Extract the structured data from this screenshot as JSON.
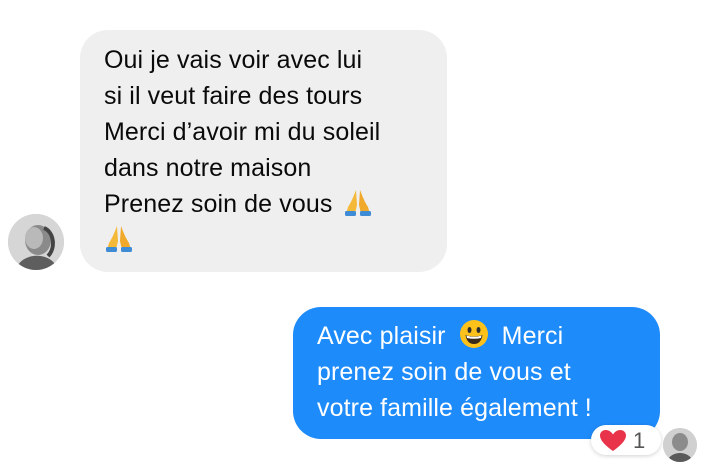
{
  "conversation": {
    "incoming_message": {
      "lines": [
        "Oui je vais voir avec lui",
        "si il veut faire des tours",
        "Merci d’avoir mi du soleil",
        "dans notre maison",
        "Prenez soin de vous"
      ],
      "emoji": [
        "folded-hands-emoji",
        "folded-hands-emoji"
      ]
    },
    "outgoing_message": {
      "line1_before_emoji": "Avec plaisir",
      "line1_after_emoji": "Merci",
      "line2": "prenez soin de vous et",
      "line3": "votre famille également !",
      "emoji": "grinning-face-emoji"
    },
    "reaction": {
      "icon": "heart-icon",
      "count": "1"
    }
  },
  "colors": {
    "incoming_bubble": "#efefef",
    "outgoing_bubble": "#1e8bfa",
    "outgoing_text": "#ffffff",
    "incoming_text": "#0a0a0a",
    "heart": "#e8334a"
  }
}
